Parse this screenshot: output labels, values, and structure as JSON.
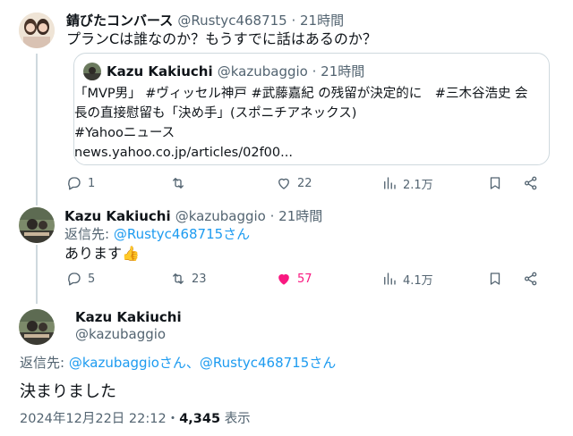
{
  "tweet1": {
    "display_name": "錆びたコンバース",
    "handle": "@Rustyc468715",
    "time": "21時間",
    "text": "プランCは誰なのか？もうすでに話はあるのか？",
    "quote": {
      "display_name": "Kazu Kakiuchi",
      "handle": "@kazubaggio",
      "time": "21時間",
      "line1": "「MVP男」 #ヴィッセル神戸 #武藤嘉紀 の残留が決定的に　#三木谷浩史 会",
      "line2": "長の直接慰留も「決め手」(スポニチアネックス)",
      "line3": "#Yahooニュース",
      "line4": "news.yahoo.co.jp/articles/02f00..."
    },
    "actions": {
      "replies": "1",
      "retweets": "",
      "likes": "22",
      "views": "2.1万"
    }
  },
  "tweet2": {
    "display_name": "Kazu Kakiuchi",
    "handle": "@kazubaggio",
    "time": "21時間",
    "reply_prefix": "返信先: ",
    "reply_to": "@Rustyc468715さん",
    "text": "あります",
    "emoji": "👍",
    "actions": {
      "replies": "5",
      "retweets": "23",
      "likes": "57",
      "views": "4.1万"
    }
  },
  "main": {
    "display_name": "Kazu Kakiuchi",
    "handle": "@kazubaggio",
    "reply_prefix": "返信先: ",
    "reply_to": "@kazubaggioさん、@Rustyc468715さん",
    "text": "決まりました",
    "timestamp": "2024年12月22日 22:12",
    "separator": "・",
    "views_count": "4,345",
    "views_label": "表示"
  },
  "colors": {
    "accent": "#1d9bf0",
    "like": "#f91880",
    "muted": "#536471",
    "border": "#cfd9de"
  },
  "icons": [
    "reply-icon",
    "retweet-icon",
    "like-icon",
    "views-icon",
    "bookmark-icon",
    "share-icon"
  ]
}
